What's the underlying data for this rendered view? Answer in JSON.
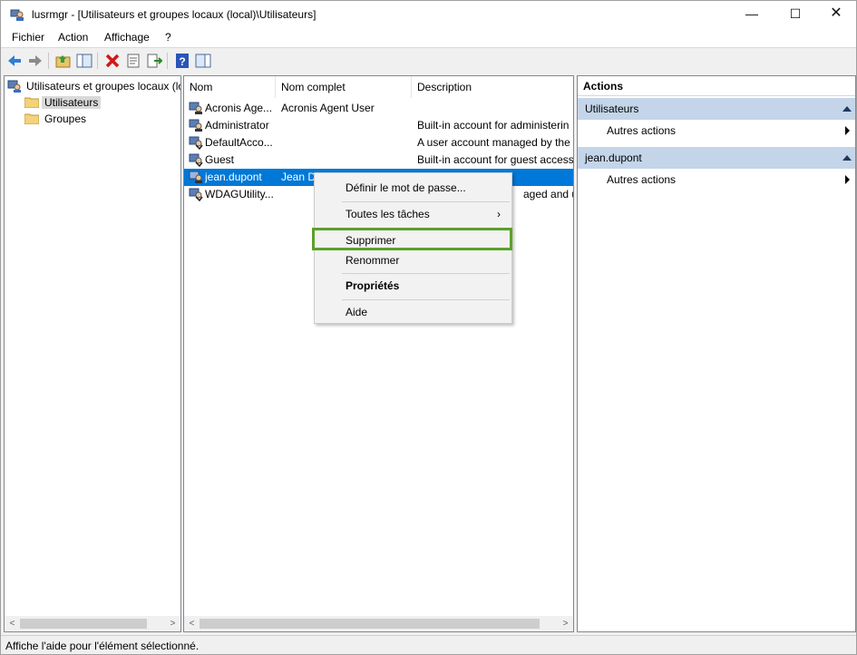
{
  "window": {
    "title": "lusrmgr - [Utilisateurs et groupes locaux (local)\\Utilisateurs]"
  },
  "window_buttons": {
    "minimize": "—",
    "maximize": "☐",
    "close": "✕"
  },
  "menu": [
    "Fichier",
    "Action",
    "Affichage",
    "?"
  ],
  "tree": {
    "root": "Utilisateurs et groupes locaux (lo",
    "items": [
      "Utilisateurs",
      "Groupes"
    ]
  },
  "list": {
    "columns": [
      "Nom",
      "Nom complet",
      "Description"
    ],
    "rows": [
      {
        "name": "Acronis Age...",
        "fullname": "Acronis Agent User",
        "description": ""
      },
      {
        "name": "Administrator",
        "fullname": "",
        "description": "Built-in account for administerin"
      },
      {
        "name": "DefaultAcco...",
        "fullname": "",
        "description": "A user account managed by the"
      },
      {
        "name": "Guest",
        "fullname": "",
        "description": "Built-in account for guest access"
      },
      {
        "name": "jean.dupont",
        "fullname": "Jean Du",
        "description": ""
      },
      {
        "name": "WDAGUtility...",
        "fullname": "",
        "description": "aged and us"
      }
    ]
  },
  "context_menu": {
    "set_password": "Définir le mot de passe...",
    "all_tasks": "Toutes les tâches",
    "delete": "Supprimer",
    "rename": "Renommer",
    "properties": "Propriétés",
    "help": "Aide"
  },
  "actions": {
    "title": "Actions",
    "groups": [
      {
        "label": "Utilisateurs",
        "item": "Autres actions"
      },
      {
        "label": "jean.dupont",
        "item": "Autres actions"
      }
    ]
  },
  "status": "Affiche l'aide pour l'élément sélectionné.",
  "colors": {
    "selection": "#0078d7",
    "highlight_box": "#5aa12b",
    "action_group": "#c4d5ea"
  }
}
